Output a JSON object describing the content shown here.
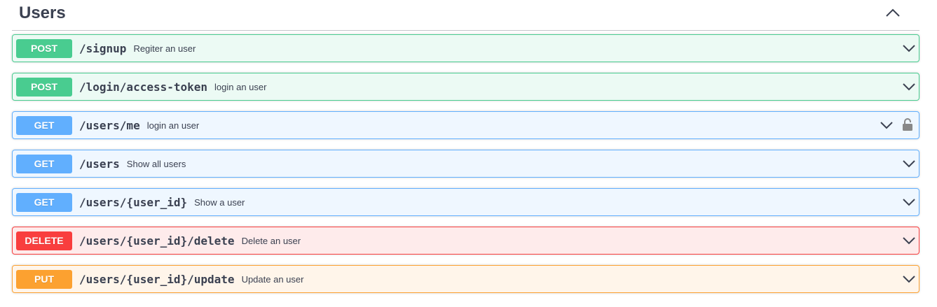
{
  "tag": {
    "title": "Users"
  },
  "operations": [
    {
      "method": "POST",
      "path": "/signup",
      "summary": "Regiter an user"
    },
    {
      "method": "POST",
      "path": "/login/access-token",
      "summary": "login an user"
    },
    {
      "method": "GET",
      "path": "/users/me",
      "summary": "login an user",
      "locked": true
    },
    {
      "method": "GET",
      "path": "/users",
      "summary": "Show all users"
    },
    {
      "method": "GET",
      "path": "/users/{user_id}",
      "summary": "Show a user"
    },
    {
      "method": "DELETE",
      "path": "/users/{user_id}/delete",
      "summary": "Delete an user"
    },
    {
      "method": "PUT",
      "path": "/users/{user_id}/update",
      "summary": "Update an user"
    }
  ],
  "icons": {
    "collapse": "chevron-up-icon",
    "expand": "chevron-down-icon",
    "auth": "lock-icon"
  },
  "colors": {
    "post": "#49cc90",
    "get": "#61affe",
    "delete": "#f93e3e",
    "put": "#fca130",
    "text": "#3b4151"
  }
}
